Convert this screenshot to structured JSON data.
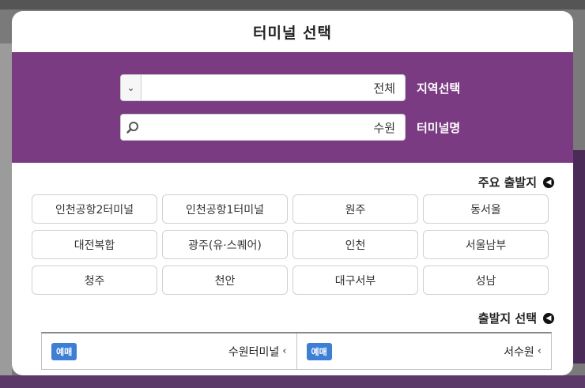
{
  "modal": {
    "title": "터미널 선택"
  },
  "search": {
    "region_label": "지역선택",
    "region_value": "전체",
    "terminal_label": "터미널명",
    "terminal_value": "수원"
  },
  "main_departures": {
    "title": "주요 출발지",
    "items": [
      "동서울",
      "원주",
      "인천공항1터미널",
      "인천공항2터미널",
      "서울남부",
      "인천",
      "광주(유·스퀘어)",
      "대전복합",
      "성남",
      "대구서부",
      "천안",
      "청주"
    ]
  },
  "departure_select": {
    "title": "출발지 선택",
    "options": [
      {
        "name": "서수원",
        "badge": "예매"
      },
      {
        "name": "수원터미널",
        "badge": "예매"
      }
    ]
  },
  "colors": {
    "panel": "#7a3b83",
    "badge": "#3d7fd4"
  }
}
